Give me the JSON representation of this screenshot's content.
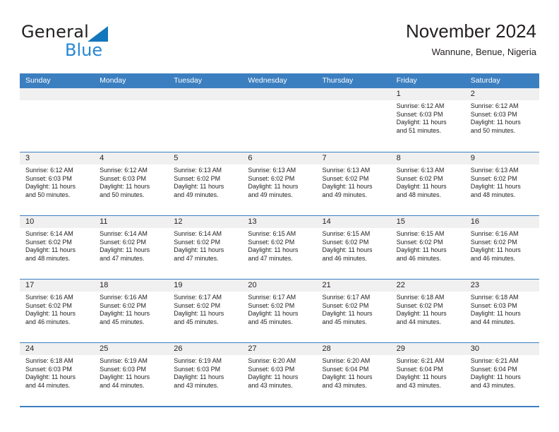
{
  "brand": {
    "word_one": "General",
    "word_two": "Blue",
    "triangle_icon": "triangle-right-icon",
    "accent_color": "#1277bc",
    "blue_text_color": "#2787d4"
  },
  "header": {
    "title": "November 2024",
    "subtitle": "Wannune, Benue, Nigeria"
  },
  "calendar": {
    "header_bg": "#3c7fc0",
    "header_text_color": "#ffffff",
    "day_band_bg": "#f0f0f0",
    "weekdays": [
      "Sunday",
      "Monday",
      "Tuesday",
      "Wednesday",
      "Thursday",
      "Friday",
      "Saturday"
    ],
    "weeks": [
      [
        {
          "day": "",
          "empty": true
        },
        {
          "day": "",
          "empty": true
        },
        {
          "day": "",
          "empty": true
        },
        {
          "day": "",
          "empty": true
        },
        {
          "day": "",
          "empty": true
        },
        {
          "day": "1",
          "sunrise": "Sunrise: 6:12 AM",
          "sunset": "Sunset: 6:03 PM",
          "daylight_1": "Daylight: 11 hours",
          "daylight_2": "and 51 minutes."
        },
        {
          "day": "2",
          "sunrise": "Sunrise: 6:12 AM",
          "sunset": "Sunset: 6:03 PM",
          "daylight_1": "Daylight: 11 hours",
          "daylight_2": "and 50 minutes."
        }
      ],
      [
        {
          "day": "3",
          "sunrise": "Sunrise: 6:12 AM",
          "sunset": "Sunset: 6:03 PM",
          "daylight_1": "Daylight: 11 hours",
          "daylight_2": "and 50 minutes."
        },
        {
          "day": "4",
          "sunrise": "Sunrise: 6:12 AM",
          "sunset": "Sunset: 6:03 PM",
          "daylight_1": "Daylight: 11 hours",
          "daylight_2": "and 50 minutes."
        },
        {
          "day": "5",
          "sunrise": "Sunrise: 6:13 AM",
          "sunset": "Sunset: 6:02 PM",
          "daylight_1": "Daylight: 11 hours",
          "daylight_2": "and 49 minutes."
        },
        {
          "day": "6",
          "sunrise": "Sunrise: 6:13 AM",
          "sunset": "Sunset: 6:02 PM",
          "daylight_1": "Daylight: 11 hours",
          "daylight_2": "and 49 minutes."
        },
        {
          "day": "7",
          "sunrise": "Sunrise: 6:13 AM",
          "sunset": "Sunset: 6:02 PM",
          "daylight_1": "Daylight: 11 hours",
          "daylight_2": "and 49 minutes."
        },
        {
          "day": "8",
          "sunrise": "Sunrise: 6:13 AM",
          "sunset": "Sunset: 6:02 PM",
          "daylight_1": "Daylight: 11 hours",
          "daylight_2": "and 48 minutes."
        },
        {
          "day": "9",
          "sunrise": "Sunrise: 6:13 AM",
          "sunset": "Sunset: 6:02 PM",
          "daylight_1": "Daylight: 11 hours",
          "daylight_2": "and 48 minutes."
        }
      ],
      [
        {
          "day": "10",
          "sunrise": "Sunrise: 6:14 AM",
          "sunset": "Sunset: 6:02 PM",
          "daylight_1": "Daylight: 11 hours",
          "daylight_2": "and 48 minutes."
        },
        {
          "day": "11",
          "sunrise": "Sunrise: 6:14 AM",
          "sunset": "Sunset: 6:02 PM",
          "daylight_1": "Daylight: 11 hours",
          "daylight_2": "and 47 minutes."
        },
        {
          "day": "12",
          "sunrise": "Sunrise: 6:14 AM",
          "sunset": "Sunset: 6:02 PM",
          "daylight_1": "Daylight: 11 hours",
          "daylight_2": "and 47 minutes."
        },
        {
          "day": "13",
          "sunrise": "Sunrise: 6:15 AM",
          "sunset": "Sunset: 6:02 PM",
          "daylight_1": "Daylight: 11 hours",
          "daylight_2": "and 47 minutes."
        },
        {
          "day": "14",
          "sunrise": "Sunrise: 6:15 AM",
          "sunset": "Sunset: 6:02 PM",
          "daylight_1": "Daylight: 11 hours",
          "daylight_2": "and 46 minutes."
        },
        {
          "day": "15",
          "sunrise": "Sunrise: 6:15 AM",
          "sunset": "Sunset: 6:02 PM",
          "daylight_1": "Daylight: 11 hours",
          "daylight_2": "and 46 minutes."
        },
        {
          "day": "16",
          "sunrise": "Sunrise: 6:16 AM",
          "sunset": "Sunset: 6:02 PM",
          "daylight_1": "Daylight: 11 hours",
          "daylight_2": "and 46 minutes."
        }
      ],
      [
        {
          "day": "17",
          "sunrise": "Sunrise: 6:16 AM",
          "sunset": "Sunset: 6:02 PM",
          "daylight_1": "Daylight: 11 hours",
          "daylight_2": "and 46 minutes."
        },
        {
          "day": "18",
          "sunrise": "Sunrise: 6:16 AM",
          "sunset": "Sunset: 6:02 PM",
          "daylight_1": "Daylight: 11 hours",
          "daylight_2": "and 45 minutes."
        },
        {
          "day": "19",
          "sunrise": "Sunrise: 6:17 AM",
          "sunset": "Sunset: 6:02 PM",
          "daylight_1": "Daylight: 11 hours",
          "daylight_2": "and 45 minutes."
        },
        {
          "day": "20",
          "sunrise": "Sunrise: 6:17 AM",
          "sunset": "Sunset: 6:02 PM",
          "daylight_1": "Daylight: 11 hours",
          "daylight_2": "and 45 minutes."
        },
        {
          "day": "21",
          "sunrise": "Sunrise: 6:17 AM",
          "sunset": "Sunset: 6:02 PM",
          "daylight_1": "Daylight: 11 hours",
          "daylight_2": "and 45 minutes."
        },
        {
          "day": "22",
          "sunrise": "Sunrise: 6:18 AM",
          "sunset": "Sunset: 6:02 PM",
          "daylight_1": "Daylight: 11 hours",
          "daylight_2": "and 44 minutes."
        },
        {
          "day": "23",
          "sunrise": "Sunrise: 6:18 AM",
          "sunset": "Sunset: 6:03 PM",
          "daylight_1": "Daylight: 11 hours",
          "daylight_2": "and 44 minutes."
        }
      ],
      [
        {
          "day": "24",
          "sunrise": "Sunrise: 6:18 AM",
          "sunset": "Sunset: 6:03 PM",
          "daylight_1": "Daylight: 11 hours",
          "daylight_2": "and 44 minutes."
        },
        {
          "day": "25",
          "sunrise": "Sunrise: 6:19 AM",
          "sunset": "Sunset: 6:03 PM",
          "daylight_1": "Daylight: 11 hours",
          "daylight_2": "and 44 minutes."
        },
        {
          "day": "26",
          "sunrise": "Sunrise: 6:19 AM",
          "sunset": "Sunset: 6:03 PM",
          "daylight_1": "Daylight: 11 hours",
          "daylight_2": "and 43 minutes."
        },
        {
          "day": "27",
          "sunrise": "Sunrise: 6:20 AM",
          "sunset": "Sunset: 6:03 PM",
          "daylight_1": "Daylight: 11 hours",
          "daylight_2": "and 43 minutes."
        },
        {
          "day": "28",
          "sunrise": "Sunrise: 6:20 AM",
          "sunset": "Sunset: 6:04 PM",
          "daylight_1": "Daylight: 11 hours",
          "daylight_2": "and 43 minutes."
        },
        {
          "day": "29",
          "sunrise": "Sunrise: 6:21 AM",
          "sunset": "Sunset: 6:04 PM",
          "daylight_1": "Daylight: 11 hours",
          "daylight_2": "and 43 minutes."
        },
        {
          "day": "30",
          "sunrise": "Sunrise: 6:21 AM",
          "sunset": "Sunset: 6:04 PM",
          "daylight_1": "Daylight: 11 hours",
          "daylight_2": "and 43 minutes."
        }
      ]
    ]
  }
}
